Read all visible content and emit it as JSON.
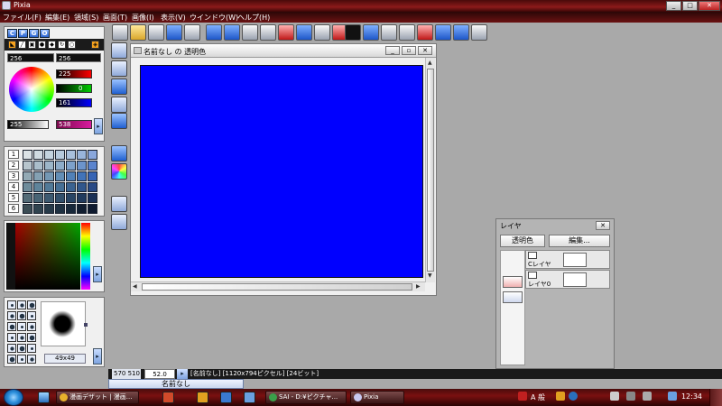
{
  "window": {
    "title": "Pixia",
    "buttons": {
      "min": "_",
      "max": "□",
      "close": "✕"
    }
  },
  "menu": [
    "ファイル(F)",
    "編集(E)",
    "領域(S)",
    "画面(T)",
    "画像(I)",
    "表示(V)",
    "ウインドウ(W)",
    "ヘルプ(H)"
  ],
  "palette": {
    "modes": [
      "C",
      "P",
      "G",
      "O"
    ],
    "tool_glyphs": [
      "◣",
      "╱",
      "▣",
      "●",
      "◆",
      "↻",
      "○",
      "◈"
    ],
    "size_values": [
      "256",
      "256"
    ],
    "rgb": {
      "r": "225",
      "g": "0",
      "b": "161"
    },
    "extra_values": [
      "255",
      "538"
    ],
    "swatch_row_labels": [
      "1",
      "2",
      "3",
      "4",
      "5",
      "6"
    ],
    "brush_size": "49x49",
    "colors": {
      "accent": "#d81b9e",
      "picked": "#c4005e"
    }
  },
  "document": {
    "title": "名前なし の 透明色",
    "buttons": {
      "min": "_",
      "restore": "▫",
      "close": "✕"
    },
    "canvas_color": "#0000ff"
  },
  "layers": {
    "title": "レイヤ",
    "close": "✕",
    "buttons": {
      "transparent": "透明色",
      "edit": "編集..."
    },
    "rows": [
      {
        "name": "Cレイヤ"
      },
      {
        "name": "レイヤ0"
      }
    ]
  },
  "status": {
    "position": "570 510",
    "zoom": "52.0",
    "info": "[名前なし] [1120x794ピクセル] [24ビット]",
    "doc_tab": "名前なし"
  },
  "taskbar": {
    "items": [
      {
        "label": "漫画デザット | 漫画...",
        "icon_color": "#e8b12c"
      },
      {
        "label": "SAI - D:¥ピクチャ...",
        "icon_color": "#3aa04a"
      },
      {
        "label": "Pixia",
        "icon_color": "#c8c8f0"
      }
    ],
    "tray_text": "A 般",
    "clock": "12:34"
  }
}
